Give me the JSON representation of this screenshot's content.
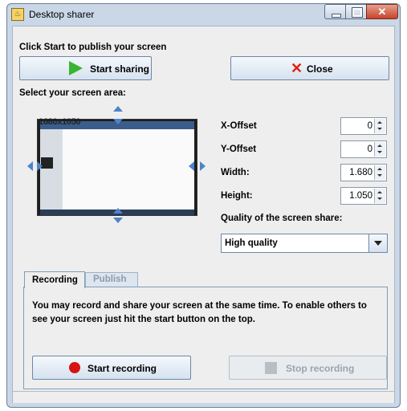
{
  "window": {
    "title": "Desktop sharer"
  },
  "labels": {
    "publish_hint": "Click Start to publish your screen",
    "select_area": "Select your screen area:"
  },
  "buttons": {
    "start_sharing": "Start sharing",
    "close": "Close",
    "start_recording": "Start recording",
    "stop_recording": "Stop recording"
  },
  "preview": {
    "resolution": "1680x1050"
  },
  "fields": {
    "x_offset": {
      "label": "X-Offset",
      "value": "0"
    },
    "y_offset": {
      "label": "Y-Offset",
      "value": "0"
    },
    "width": {
      "label": "Width:",
      "value": "1.680"
    },
    "height": {
      "label": "Height:",
      "value": "1.050"
    }
  },
  "quality": {
    "label": "Quality of the screen share:",
    "selected": "High quality"
  },
  "tabs": [
    {
      "label": "Recording",
      "active": true
    },
    {
      "label": "Publish",
      "active": false
    }
  ],
  "recording": {
    "text": "You may record and share your screen at the same time. To enable others to see your screen just hit the start button on the top."
  },
  "icons": {
    "app": "java-app-icon",
    "start_sharing": "play-icon",
    "close": "close-x-icon",
    "start_recording": "record-dot-icon",
    "stop_recording": "stop-square-icon"
  },
  "colors": {
    "play_green": "#39b530",
    "close_red": "#e01f10",
    "record_red": "#d81313",
    "arrow_blue": "#4d84c9"
  }
}
